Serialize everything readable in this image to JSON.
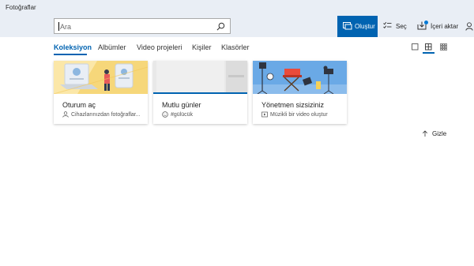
{
  "app": {
    "title": "Fotoğraflar"
  },
  "search": {
    "placeholder": "Ara"
  },
  "toolbar": {
    "create_label": "Oluştur",
    "select_label": "Seç",
    "import_label": "İçeri aktar"
  },
  "tabs": [
    {
      "label": "Koleksiyon",
      "active": true
    },
    {
      "label": "Albümler"
    },
    {
      "label": "Video projeleri"
    },
    {
      "label": "Kişiler"
    },
    {
      "label": "Klasörler"
    }
  ],
  "cards": [
    {
      "title": "Oturum aç",
      "subtitle": "Cihazlarınızdan fotoğraflar..."
    },
    {
      "title": "Mutlu günler",
      "subtitle": "#gülücük"
    },
    {
      "title": "Yönetmen sizsiziniz",
      "subtitle": "Müzikli bir video oluştur"
    }
  ],
  "hide": {
    "label": "Gizle"
  },
  "colors": {
    "accent": "#0063b1",
    "header_bg": "#e9eef5"
  }
}
